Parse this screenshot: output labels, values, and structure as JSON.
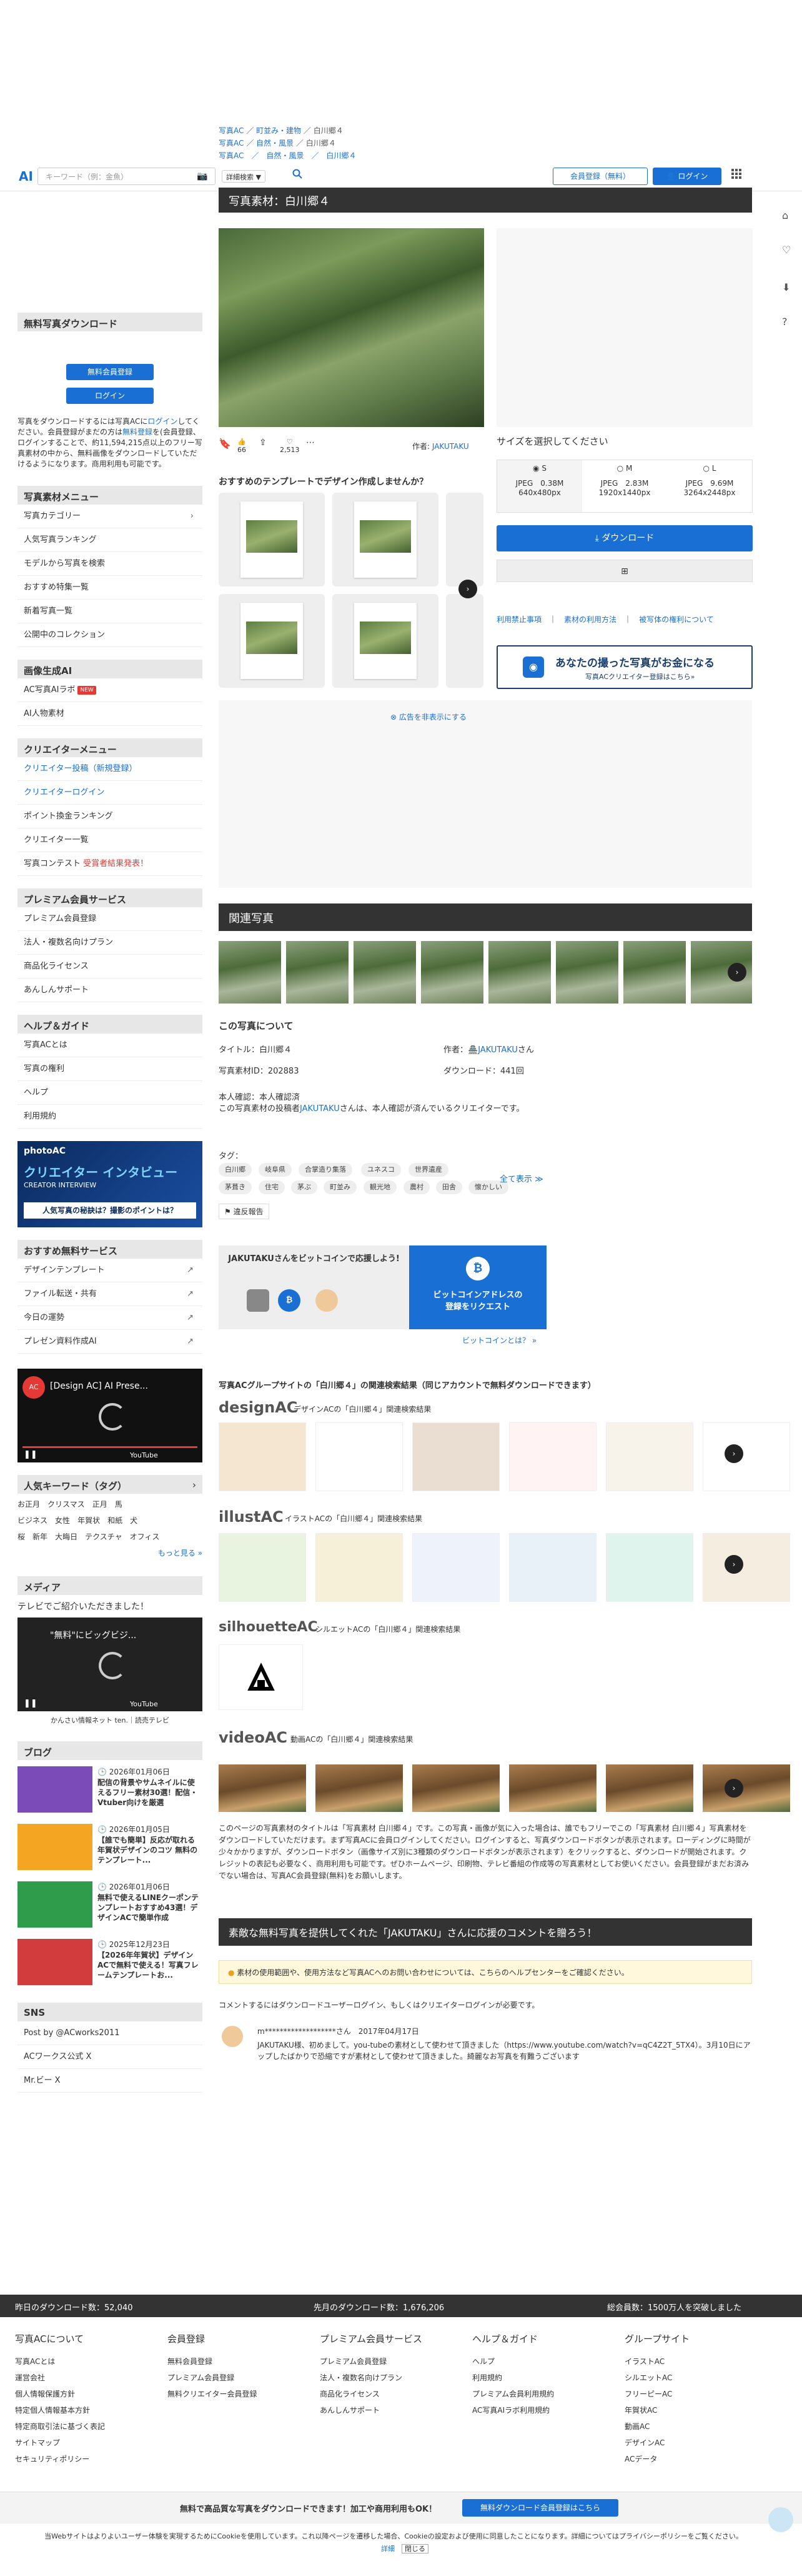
{
  "header": {
    "logo": "AI",
    "search_placeholder": "キーワード（例：金魚）",
    "search_mode": "詳細検索 ▼",
    "register": "会員登録（無料）",
    "login": "ログイン"
  },
  "breadcrumb": {
    "line1": [
      "写真AC",
      "町並み・建物",
      "白川郷４"
    ],
    "line2": [
      "写真AC",
      "自然・風景",
      "白川郷４"
    ],
    "line3": "写真AC　／　自然・風景　／　白川郷４"
  },
  "title": "写真素材：白川郷４",
  "ad": {
    "hide": "広告を非表示にする"
  },
  "sidebar": {
    "download_head": "無料写真ダウンロード",
    "free_register": "無料会員登録",
    "login": "ログイン",
    "desc1": "写真をダウンロードするには写真ACに",
    "desc1_link": "ログイン",
    "desc2": "してください。会員登録がまだの方は",
    "desc2_link": "無料登録",
    "desc3": "を(会員登録、ログインすることで、約11,594,215点以上のフリー写真素材の中から、無料画像をダウンロードしていただけるようになります。商用利用も可能です。",
    "menu_head": "写真素材メニュー",
    "menu": [
      "写真カテゴリー",
      "人気写真ランキング",
      "モデルから写真を検索",
      "おすすめ特集一覧",
      "新着写真一覧",
      "公開中のコレクション"
    ],
    "ai_head": "画像生成AI",
    "ai_items": [
      "AC写真AIラボ",
      "AI人物素材"
    ],
    "new_badge": "NEW",
    "creator_head": "クリエイターメニュー",
    "creator_items": [
      "クリエイター投稿（新規登録）",
      "クリエイターログイン",
      "ポイント換金ランキング",
      "クリエイター一覧",
      "写真コンテスト"
    ],
    "contest_note": "受賞者結果発表！",
    "premium_head": "プレミアム会員サービス",
    "premium_items": [
      "プレミアム会員登録",
      "法人・複数名向けプラン",
      "商品化ライセンス",
      "あんしんサポート"
    ],
    "help_head": "ヘルプ＆ガイド",
    "help_items": [
      "写真ACとは",
      "写真の権利",
      "ヘルプ",
      "利用規約"
    ],
    "banner": {
      "logo": "photoAC",
      "title": "クリエイター インタビュー",
      "sub": "CREATOR INTERVIEW",
      "tag": "人気写真の秘訣は？撮影のポイントは？"
    },
    "services_head": "おすすめ無料サービス",
    "services": [
      "デザインテンプレート",
      "ファイル転送・共有",
      "今日の運勢",
      "プレゼン資料作成AI"
    ],
    "video1": {
      "title": "[Design AC] AI Prese...",
      "brand": "YouTube"
    },
    "keywords_head": "人気キーワード（タグ）",
    "keywords": [
      [
        "お正月",
        "クリスマス",
        "正月",
        "馬"
      ],
      [
        "ビジネス",
        "女性",
        "年賀状",
        "和紙",
        "犬"
      ],
      [
        "桜",
        "新年",
        "大晦日",
        "テクスチャ",
        "オフィス"
      ]
    ],
    "more": "もっと見る »",
    "media_head": "メディア",
    "media_text": "テレビでご紹介いただきました！",
    "video2": {
      "title": "\"無料\"にビッグビジ...",
      "brand": "YouTube"
    },
    "media_caption": "かんさい情報ネット ten.｜読売テレビ",
    "blog_head": "ブログ",
    "blog": [
      {
        "date": "2026年01月06日",
        "title": "配信の背景やサムネイルに使えるフリー素材30選！配信・Vtuber向けを厳選"
      },
      {
        "date": "2026年01月05日",
        "title": "【誰でも簡単】反応が取れる年賀状デザインのコツ 無料のテンプレート..."
      },
      {
        "date": "2026年01月06日",
        "title": "無料で使えるLINEクーポンテンプレートおすすめ43選！デザインACで簡単作成"
      },
      {
        "date": "2025年12月23日",
        "title": "【2026年年賀状】デザインACで無料で使える！写真フレームテンプレートお..."
      }
    ],
    "sns_head": "SNS",
    "sns": [
      "Post by @ACworks2011",
      "ACワークス公式 X",
      "Mr.ビー X"
    ]
  },
  "photo": {
    "likes": "66",
    "views": "2,513",
    "author_label": "作者:",
    "author": "JAKUTAKU"
  },
  "templates_head": "おすすめのテンプレートでデザイン作成しませんか？",
  "size": {
    "head": "サイズを選択してください",
    "options": [
      {
        "label": "S",
        "format": "JPEG",
        "filesize": "0.38M",
        "dims": "640x480px",
        "selected": true
      },
      {
        "label": "M",
        "format": "JPEG",
        "filesize": "2.83M",
        "dims": "1920x1440px",
        "selected": false
      },
      {
        "label": "L",
        "format": "JPEG",
        "filesize": "9.69M",
        "dims": "3264x2448px",
        "selected": false
      }
    ],
    "download": "ダウンロード",
    "links": [
      "利用禁止事項",
      "素材の利用方法",
      "被写体の権利について"
    ],
    "promo_title": "あなたの撮った写真がお金になる",
    "promo_sub": "写真ACクリエイター登録はこちら»"
  },
  "related_head": "関連写真",
  "about": {
    "head": "この写真について",
    "title_label": "タイトル：白川郷４",
    "author_label": "作者：",
    "author": "JAKUTAKU",
    "author_suffix": "さん",
    "id_label": "写真素材ID：202883",
    "downloads_label": "ダウンロード：441回",
    "verify1": "本人確認：本人確認済",
    "verify2a": "この写真素材の投稿者",
    "verify2b": "さんは、本人確認が済んでいるクリエイターです。",
    "tag_label": "タグ：",
    "tags": [
      [
        "白川郷",
        "岐阜県",
        "合掌造り集落",
        "ユネスコ",
        "世界遺産"
      ],
      [
        "茅葺き",
        "住宅",
        "茅ぶ",
        "町並み",
        "観光地",
        "農村",
        "田舎",
        "懐かしい"
      ]
    ],
    "show_all": "全て表示 ≫",
    "report": "違反報告"
  },
  "bitcoin": {
    "support": "JAKUTAKUさんをビットコインで応援しよう!",
    "btn1": "ビットコインアドレスの",
    "btn2": "登録をリクエスト",
    "what": "ビットコインとは？ »"
  },
  "group": {
    "head": "写真ACグループサイトの「白川郷４」の関連検索結果（同じアカウントで無料ダウンロードできます）",
    "design_logo": "designAC",
    "design_text": "デザインACの「白川郷４」関連検索結果",
    "illust_logo": "illustAC",
    "illust_text": "イラストACの「白川郷４」関連検索結果",
    "silhouette_logo": "silhouetteAC",
    "silhouette_text": "シルエットACの「白川郷４」関連検索結果",
    "video_logo": "videoAC",
    "video_text": "動画ACの「白川郷４」関連検索結果"
  },
  "description": "このページの写真素材のタイトルは「写真素材 白川郷４」です。この写真・画像が気に入った場合は、誰でもフリーでこの「写真素材 白川郷４」写真素材をダウンロードしていただけます。まず写真ACに会員ログインしてください。ログインすると、写真ダウンロードボタンが表示されます。ローディングに時間が少々かかりますが、ダウンロードボタン（画像サイズ別に3種類のダウンロードボタンが表示されます）をクリックすると、ダウンロードが開始されます。クレジットの表記も必要なく、商用利用も可能です。ぜひホームページ、印刷物、テレビ番組の作成等の写真素材としてお使いください。会員登録がまだお済みでない場合は、写真AC会員登録(無料)をお願いします。",
  "comment": {
    "head": "素敵な無料写真を提供してくれた「JAKUTAKU」さんに応援のコメントを贈ろう！",
    "notice": "素材の使用範囲や、使用方法など写真ACへのお問い合わせについては、こちらのヘルプセンターをご確認ください。",
    "login_note": "コメントするにはダウンロードユーザーログイン、もしくはクリエイターログインが必要です。",
    "user": "m*******************さん",
    "date": "2017年04月17日",
    "text": "JAKUTAKU様、初めまして。you-tubeの素材として使わせて頂きました（https://www.youtube.com/watch?v=qC4Z2T_5TX4）。3月10日にアップしたばかりで恐縮ですが素材として使わせて頂きました。綺麗なお写真を有難うございます"
  },
  "stats": {
    "today": "昨日のダウンロード数：52,040",
    "month": "先月のダウンロード数：1,676,206",
    "total": "総会員数：1500万人を突破しました"
  },
  "footer": {
    "cols": [
      {
        "head": "写真ACについて",
        "items": [
          "写真ACとは",
          "運営会社",
          "個人情報保護方針",
          "特定個人情報基本方針",
          "特定商取引法に基づく表記",
          "サイトマップ",
          "セキュリティポリシー"
        ]
      },
      {
        "head": "会員登録",
        "items": [
          "無料会員登録",
          "プレミアム会員登録",
          "無料クリエイター会員登録"
        ]
      },
      {
        "head": "プレミアム会員サービス",
        "items": [
          "プレミアム会員登録",
          "法人・複数名向けプラン",
          "商品化ライセンス",
          "あんしんサポート"
        ]
      },
      {
        "head": "ヘルプ＆ガイド",
        "items": [
          "ヘルプ",
          "利用規約",
          "プレミアム会員利用規約",
          "AC写真AIラボ利用規約"
        ]
      },
      {
        "head": "グループサイト",
        "items": [
          "イラストAC",
          "シルエットAC",
          "フリーピーAC",
          "年賀状AC",
          "動画AC",
          "デザインAC",
          "ACデータ"
        ]
      }
    ]
  },
  "bottom_banner": {
    "text": "無料で高品質な写真をダウンロードできます！加工や商用利用もOK！",
    "btn": "無料ダウンロード会員登録はこちら"
  },
  "cookie": {
    "text": "当Webサイトはよりよいユーザー体験を実現するためにCookieを使用しています。これ以降ページを遷移した場合、Cookieの設定および使用に同意したことになります。詳細についてはプライバシーポリシーをご覧ください。",
    "link": "詳細",
    "close": "閉じる"
  }
}
